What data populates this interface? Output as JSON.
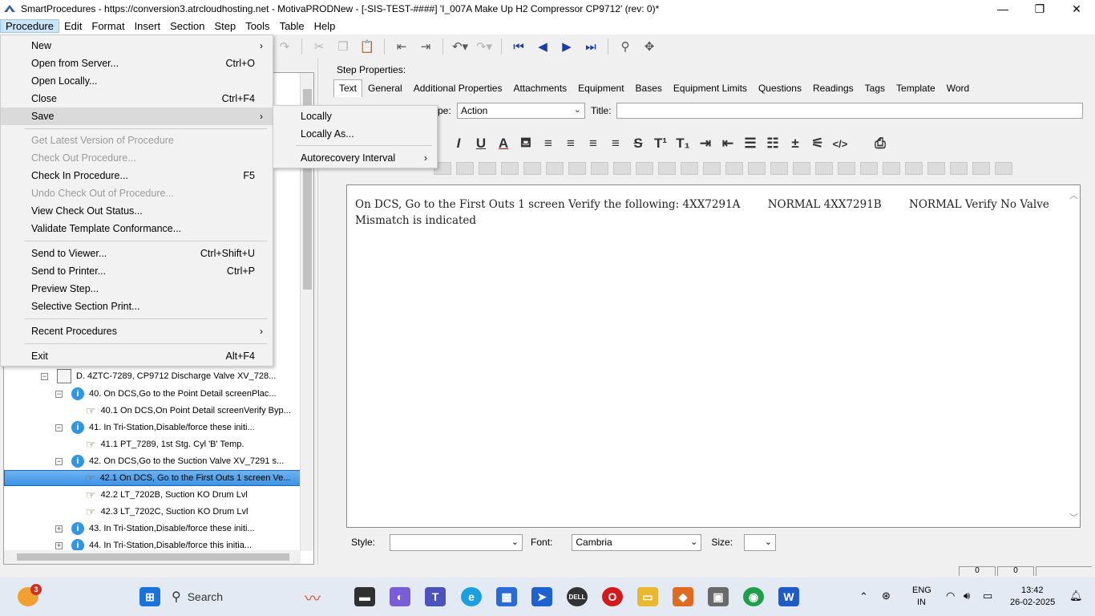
{
  "window": {
    "title": "SmartProcedures - https://conversion3.atrcloudhosting.net - MotivaPRODNew - [-SIS-TEST-####] 'I_007A Make Up H2 Compressor CP9712' (rev: 0)*",
    "minimize": "—",
    "maximize": "❐",
    "close": "✕"
  },
  "menubar": [
    "Procedure",
    "Edit",
    "Format",
    "Insert",
    "Section",
    "Step",
    "Tools",
    "Table",
    "Help"
  ],
  "procedure_menu": {
    "items": [
      {
        "label": "New",
        "shortcut": "",
        "arrow": "›"
      },
      {
        "label": "Open from Server...",
        "shortcut": "Ctrl+O",
        "arrow": ""
      },
      {
        "label": "Open Locally...",
        "shortcut": "",
        "arrow": ""
      },
      {
        "label": "Close",
        "shortcut": "Ctrl+F4",
        "arrow": ""
      },
      {
        "label": "Save",
        "shortcut": "",
        "arrow": "›"
      },
      {
        "label": "Get Latest Version of Procedure",
        "shortcut": "",
        "arrow": ""
      },
      {
        "label": "Check Out Procedure...",
        "shortcut": "",
        "arrow": ""
      },
      {
        "label": "Check In Procedure...",
        "shortcut": "F5",
        "arrow": ""
      },
      {
        "label": "Undo Check Out of Procedure...",
        "shortcut": "",
        "arrow": ""
      },
      {
        "label": "View Check Out Status...",
        "shortcut": "",
        "arrow": ""
      },
      {
        "label": "Validate Template Conformance...",
        "shortcut": "",
        "arrow": ""
      },
      {
        "label": "Send to Viewer...",
        "shortcut": "Ctrl+Shift+U",
        "arrow": ""
      },
      {
        "label": "Send to Printer...",
        "shortcut": "Ctrl+P",
        "arrow": ""
      },
      {
        "label": "Preview Step...",
        "shortcut": "",
        "arrow": ""
      },
      {
        "label": "Selective Section Print...",
        "shortcut": "",
        "arrow": ""
      },
      {
        "label": "Recent Procedures",
        "shortcut": "",
        "arrow": "›"
      },
      {
        "label": "Exit",
        "shortcut": "Alt+F4",
        "arrow": ""
      }
    ]
  },
  "save_submenu": {
    "items": [
      {
        "label": "Locally",
        "arrow": ""
      },
      {
        "label": "Locally As...",
        "arrow": ""
      },
      {
        "label": "Autorecovery Interval",
        "arrow": "›"
      }
    ]
  },
  "tree": {
    "rows": [
      {
        "label": "D. 4ZTC-7289, CP9712 Discharge Valve XV_728...",
        "expander": "−",
        "icon": "document-icon"
      },
      {
        "label": "40. On DCS,Go to the Point Detail screenPlac...",
        "expander": "−",
        "icon": "info-icon"
      },
      {
        "label": "40.1 On DCS,On Point Detail screenVerify Byp...",
        "expander": "",
        "icon": "pointing-hand-icon"
      },
      {
        "label": "41. In Tri-Station,Disable/force these initi...",
        "expander": "−",
        "icon": "info-icon"
      },
      {
        "label": "41.1 PT_7289, 1st Stg. Cyl 'B' Temp.",
        "expander": "",
        "icon": "pointing-hand-icon"
      },
      {
        "label": "42. On DCS,Go to the Suction Valve XV_7291 s...",
        "expander": "−",
        "icon": "info-icon"
      },
      {
        "label": "42.1 On DCS, Go to the First Outs 1 screen Ve...",
        "expander": "",
        "icon": "pointing-hand-icon"
      },
      {
        "label": "42.2 LT_7202B, Suction KO Drum Lvl",
        "expander": "",
        "icon": "pointing-hand-icon"
      },
      {
        "label": "42.3 LT_7202C, Suction KO Drum Lvl",
        "expander": "",
        "icon": "pointing-hand-icon"
      },
      {
        "label": "43. In Tri-Station,Disable/force these initi...",
        "expander": "+",
        "icon": "info-icon"
      },
      {
        "label": "44. In Tri-Station,Disable/force this initia...",
        "expander": "+",
        "icon": "info-icon"
      }
    ],
    "selected_index": 6
  },
  "step": {
    "properties_label": "Step Properties:",
    "tabs": [
      "Text",
      "General",
      "Additional Properties",
      "Attachments",
      "Equipment",
      "Bases",
      "Equipment Limits",
      "Questions",
      "Readings",
      "Tags",
      "Template",
      "Word"
    ],
    "active_tab": "Text",
    "type_label": "pe:",
    "type_value": "Action",
    "title_label": "Title:",
    "title_value": "",
    "body_text": "On DCS, Go to the First Outs 1 screen Verify the following: 4XX7291A        NORMAL 4XX7291B        NORMAL Verify No Valve Mismatch is indicated",
    "style_label": "Style:",
    "style_value": "",
    "font_label": "Font:",
    "font_value": "Cambria",
    "size_label": "Size:",
    "size_value": "",
    "status_cells": [
      "0",
      "0"
    ]
  },
  "format_buttons": [
    "I",
    "U",
    "A",
    "⛾",
    "≡",
    "≡",
    "≡",
    "≡",
    "S",
    "T¹",
    "T₁",
    "⇥",
    "⇤",
    "☰",
    "☷",
    "±",
    "⚟",
    "</>",
    "⎙"
  ],
  "taskbar": {
    "search_label": "Search",
    "notification_count": "3",
    "language": "ENG",
    "region": "IN",
    "time": "13:42",
    "date": "26-02-2025"
  }
}
